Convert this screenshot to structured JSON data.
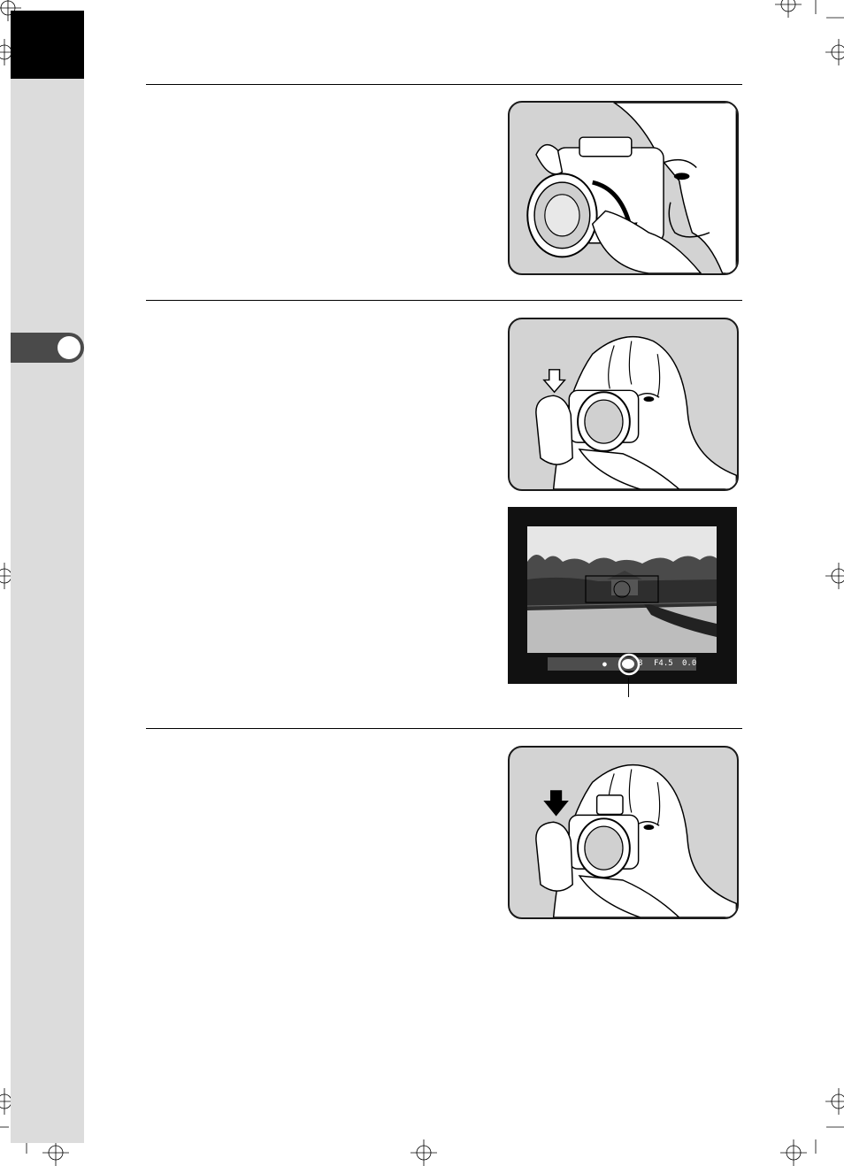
{
  "viewfinder": {
    "aperture": "F4.5",
    "exposure_comp": "0.0"
  }
}
